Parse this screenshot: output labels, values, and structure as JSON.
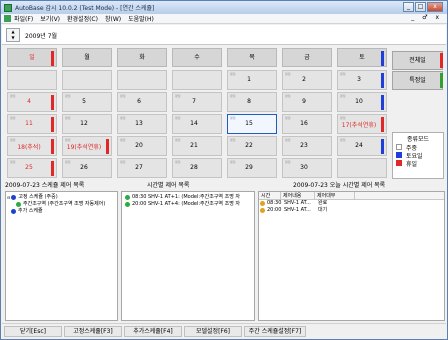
{
  "window": {
    "title": "AutoBase 감시 10.0.2 (Test Mode) - [연간 스케쥴]",
    "controls": [
      "_",
      "□",
      "x"
    ],
    "mdi_controls": "_ ♂ x"
  },
  "menu": [
    "파일(F)",
    "보기(V)",
    "환경설정(C)",
    "창(W)",
    "도움말(H)"
  ],
  "date": {
    "month_label": "2009년 7월",
    "spin_up": "▲",
    "spin_down": "▼"
  },
  "calendar": {
    "weekdays": [
      "일",
      "월",
      "화",
      "수",
      "목",
      "금",
      "토"
    ],
    "cell_tag": "평일",
    "weeks": [
      [
        "",
        "",
        "",
        "",
        "1",
        "2",
        "3"
      ],
      [
        "4",
        "5",
        "6",
        "7",
        "8",
        "9",
        "10"
      ],
      [
        "11",
        "12",
        "13",
        "14",
        "15",
        "16",
        "17(추석연휴)"
      ],
      [
        "18(추석)",
        "19(추석연휴)",
        "20",
        "21",
        "22",
        "23",
        "24"
      ],
      [
        "25",
        "26",
        "27",
        "28",
        "29",
        "30",
        ""
      ]
    ],
    "today": "15"
  },
  "right_panel": {
    "btn1": "전체일",
    "btn2": "특정일",
    "legend_title": "종류모드",
    "legend": [
      {
        "label": "주중",
        "color": "#ffffff"
      },
      {
        "label": "토요일",
        "color": "#1f3fd8"
      },
      {
        "label": "휴일",
        "color": "#e02828"
      }
    ]
  },
  "panes": {
    "left_title": "2009-07-23 스케쥴 제어 목록",
    "mid_title": "시간별 제어 목록",
    "right_title": "2009-07-23 오늘 시간별 제어 목록",
    "tree": [
      "고정 스케쥴 (주중)",
      "주간조구역 (주간조구역 조명 자동제어)",
      "추가 스케쥴"
    ],
    "mid_lines": [
      "08:30 SHV-1 AT+1: (Model:주간조구역 조명 자",
      "20:00 SHV-1 AT+4: (Model:주간조구역 조명 자"
    ],
    "cols": [
      "시간",
      "제어내용",
      "제어대부"
    ],
    "rows": [
      {
        "time": "08:30",
        "content": "SHV-1 AT...",
        "state": "완료"
      },
      {
        "time": "20:00",
        "content": "SHV-1 AT...",
        "state": "대기"
      }
    ]
  },
  "buttons": [
    "닫기[Esc]",
    "고정스케쥴[F3]",
    "추가스케쥴[F4]",
    "모델설정[F6]",
    "주간 스케쥴설정[F7]"
  ]
}
